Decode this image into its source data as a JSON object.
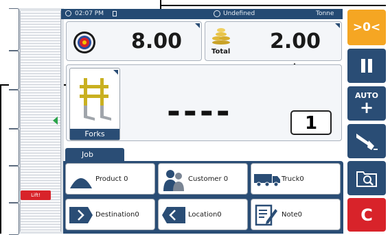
{
  "status": {
    "time": "02:07 PM",
    "mode": "Undefined",
    "unit": "Tonne"
  },
  "weigh": {
    "target_value": "8.00",
    "total_value": "2.00",
    "total_label": "Total"
  },
  "attachment": {
    "label": "Forks"
  },
  "display": {
    "dashes": "----",
    "counter": "1"
  },
  "left": {
    "lift_label": "Lift!"
  },
  "right_buttons": {
    "zero_label": ">0<",
    "auto_label": "AUTO",
    "clear_label": "C"
  },
  "job": {
    "tab_label": "Job",
    "buttons": [
      {
        "label": "Product 0"
      },
      {
        "label": "Customer 0"
      },
      {
        "label": "Truck0"
      },
      {
        "label": "Destination0"
      },
      {
        "label": "Location0"
      },
      {
        "label": "Note0"
      }
    ]
  },
  "colors": {
    "orange": "#f5a623",
    "blue": "#2a4d75",
    "red": "#d8232a",
    "green": "#2aa44a"
  }
}
